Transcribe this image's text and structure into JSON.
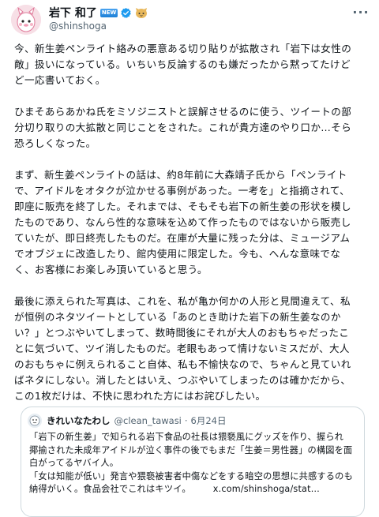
{
  "author": {
    "name": "岩下 和了",
    "badge": "NEW",
    "handle": "@shinshoga"
  },
  "more_label": "···",
  "paragraphs": [
    "今、新生姜ペンライト絡みの悪意ある切り貼りが拡散され「岩下は女性の\n敵」扱いになっている。いちいち反論するのも嫌だったから黙ってたけど\nど一応書いておく。",
    "ひまそあらあかね氏をミソジニストと誤解させるのに使う、ツイートの部\n分切り取りの大拡散と同じことをされた。これが貴方達のやり口か…そら\n恐ろしくなった。",
    "まず、新生姜ペンライトの話は、約8年前に大森靖子氏から「ペンライト\nで、アイドルをオタクが泣かせる事例があった。一考を」と指摘されて、\n即座に販売を終了した。それまでは、そもそも岩下の新生姜の形状を模し\nたものであり、なんら性的な意味を込めて作ったものではないから販売し\nていたが、即日終売したものだ。在庫が大量に残った分は、ミュージアム\nでオブジェに改造したり、館内使用に限定した。今も、へんな意味でな\nく、お客様にお楽しみ頂いていると思う。",
    "最後に添えられた写真は、これを、私が亀か何かの人形と見間違えて、私\nが恒例のネタツイートとしている「あのとき助けた岩下の新生姜なのか\nい？」とつぶやいてしまって、数時間後にそれが大人のおもちゃだったこ\nとに気づいて、ツイ消したものだ。老眼もあって情けないミスだが、大人\nのおもちゃに例えられること自体、私も不愉快なので、ちゃんと見ていれ\nばネタにしない。消したとはいえ、つぶやいてしまったのは確かだから、\nこの1枚だけは、不快に思われた方にはお詫びしたい。"
  ],
  "quote": {
    "name": "きれいなたわし",
    "handle": "@clean_tawasi",
    "dot": "·",
    "date": "6月24日",
    "text": "「岩下の新生姜」で知られる岩下食品の社長は猥褻風にグッズを作り、握られ\n揶揄された未成年アイドルが泣く事件の後でもまだ「生姜＝男性器」の構図を面\n白がってるヤバイ人。\n「女は知能が低い」発言や猥褻被害者中傷などをする暗空の思想に共感するのも\n納得がいく。食品会社でこれはキツイ。",
    "link": "x.com/shinshoga/stat…"
  }
}
